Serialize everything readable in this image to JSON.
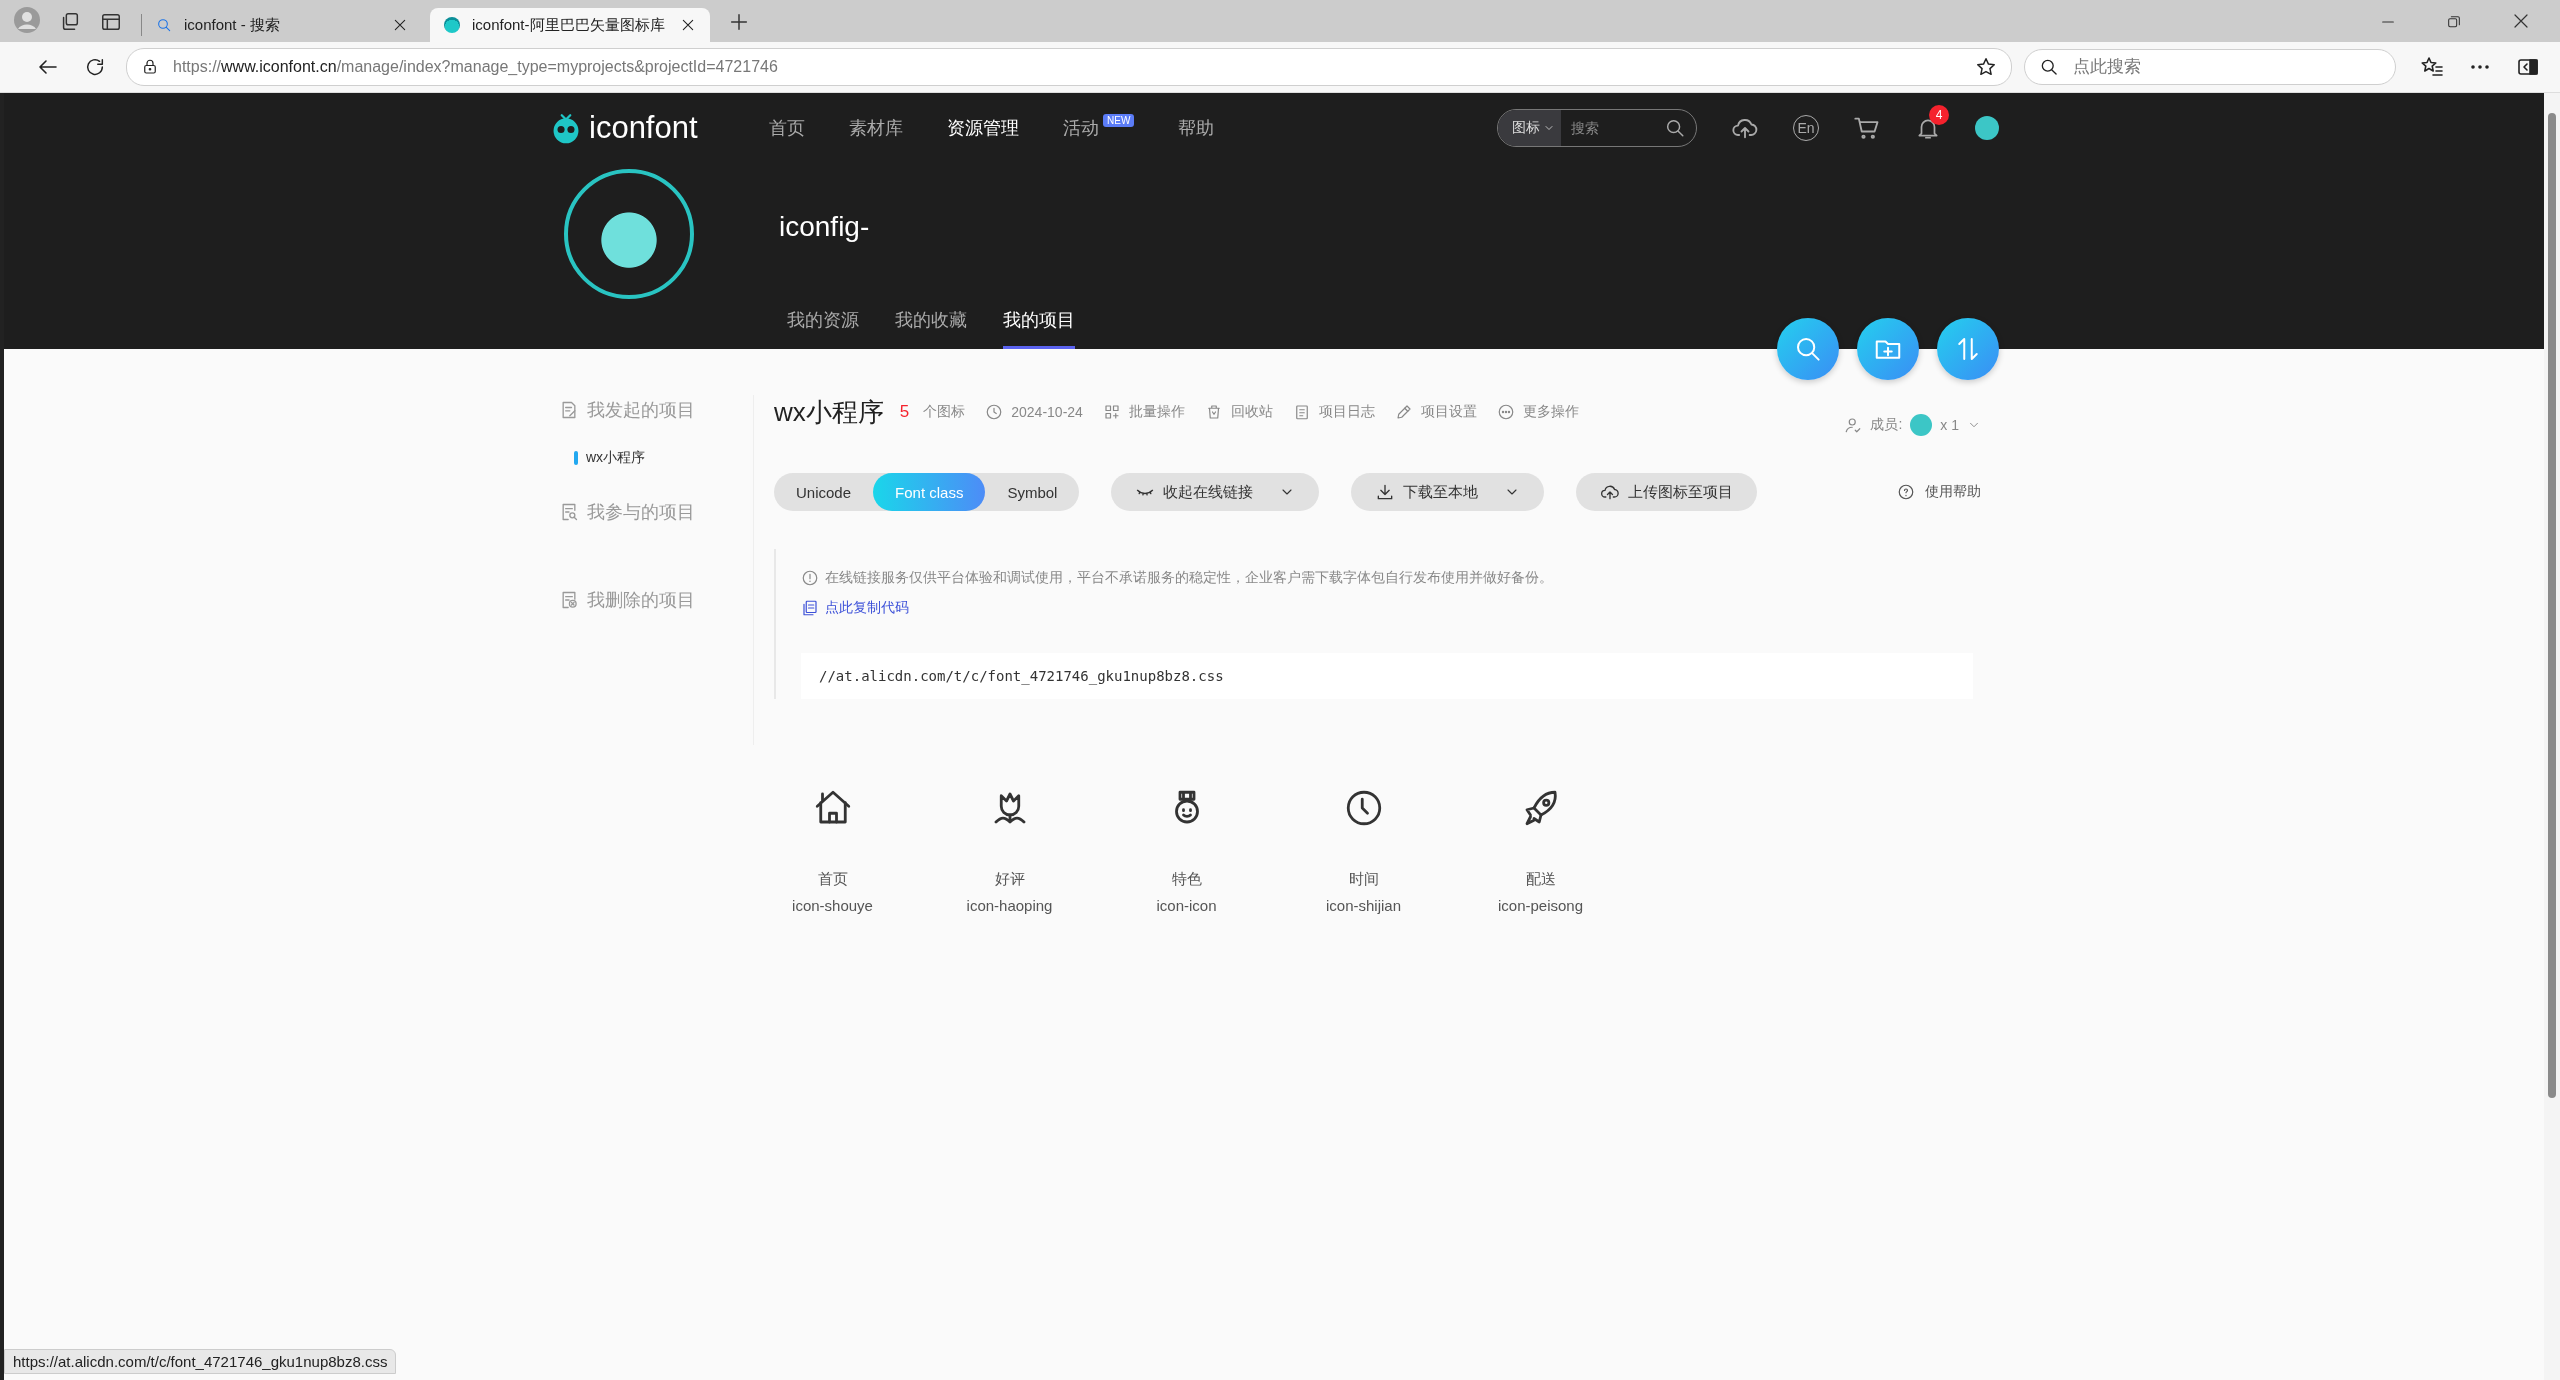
{
  "browser": {
    "tabs": [
      {
        "title": "iconfont - 搜索",
        "selected": false
      },
      {
        "title": "iconfont-阿里巴巴矢量图标库",
        "selected": true
      }
    ],
    "address": {
      "scheme": "https://",
      "host": "www.iconfont.cn",
      "path": "/manage/index?manage_type=myprojects&projectId=4721746"
    },
    "search": {
      "placeholder": "点此搜索"
    }
  },
  "site": {
    "logo": "iconfont",
    "nav": [
      {
        "label": "首页",
        "selected": false
      },
      {
        "label": "素材库",
        "selected": false
      },
      {
        "label": "资源管理",
        "selected": true
      },
      {
        "label": "活动",
        "selected": false,
        "badge": "NEW"
      },
      {
        "label": "帮助",
        "selected": false
      }
    ],
    "search": {
      "scope": "图标",
      "placeholder": "搜索"
    },
    "language": "En",
    "notification_count": "4"
  },
  "profile": {
    "username": "iconfig-",
    "tabs": [
      {
        "label": "我的资源",
        "selected": false
      },
      {
        "label": "我的收藏",
        "selected": false
      },
      {
        "label": "我的项目",
        "selected": true
      }
    ]
  },
  "sidebar": {
    "groups": [
      {
        "label": "我发起的项目",
        "children": [
          {
            "label": "wx小程序",
            "selected": true
          }
        ]
      },
      {
        "label": "我参与的项目"
      },
      {
        "label": "我删除的项目"
      }
    ]
  },
  "project": {
    "name": "wx小程序",
    "icon_count": "5",
    "icon_count_label": "个图标",
    "date": "2024-10-24",
    "actions": [
      "批量操作",
      "回收站",
      "项目日志",
      "项目设置",
      "更多操作"
    ],
    "members_label": "成员:",
    "members_count": "x 1",
    "modes": [
      {
        "label": "Unicode",
        "selected": false
      },
      {
        "label": "Font class",
        "selected": true
      },
      {
        "label": "Symbol",
        "selected": false
      }
    ],
    "buttons": [
      {
        "label": "收起在线链接",
        "kind": "dropdown"
      },
      {
        "label": "下载至本地",
        "kind": "dropdown"
      },
      {
        "label": "上传图标至项目",
        "kind": "plain"
      }
    ],
    "help": "使用帮助",
    "notice": "在线链接服务仅供平台体验和调试使用，平台不承诺服务的稳定性，企业客户需下载字体包自行发布使用并做好备份。",
    "copy_code": "点此复制代码",
    "code": "//at.alicdn.com/t/c/font_4721746_gku1nup8bz8.css"
  },
  "icons": [
    {
      "name": "首页",
      "class": "icon-shouye"
    },
    {
      "name": "好评",
      "class": "icon-haoping"
    },
    {
      "name": "特色",
      "class": "icon-icon"
    },
    {
      "name": "时间",
      "class": "icon-shijian"
    },
    {
      "name": "配送",
      "class": "icon-peisong"
    }
  ],
  "status_url": "https://at.alicdn.com/t/c/font_4721746_gku1nup8bz8.css"
}
